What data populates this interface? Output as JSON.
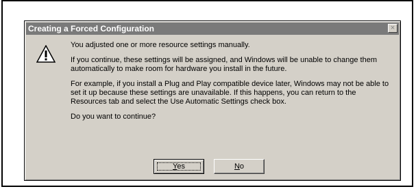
{
  "dialog": {
    "title": "Creating a Forced Configuration",
    "close_glyph": "×",
    "icon": "warning-icon",
    "paragraphs": [
      "You adjusted one or more resource settings manually.",
      "If you continue, these settings will be assigned, and Windows will be unable to change them automatically to make room for hardware you install in the future.",
      "For example, if you install a Plug and Play compatible device later,  Windows may not be able to set it up because these settings are unavailable. If this happens, you can return to the Resources tab and select the Use Automatic Settings check box.",
      "Do you want to continue?"
    ],
    "buttons": {
      "yes_mnemonic": "Y",
      "yes_rest": "es",
      "no_mnemonic": "N",
      "no_rest": "o"
    }
  },
  "colors": {
    "titlebar": "#7a7a7a",
    "dialog_face": "#d4d0c8"
  }
}
